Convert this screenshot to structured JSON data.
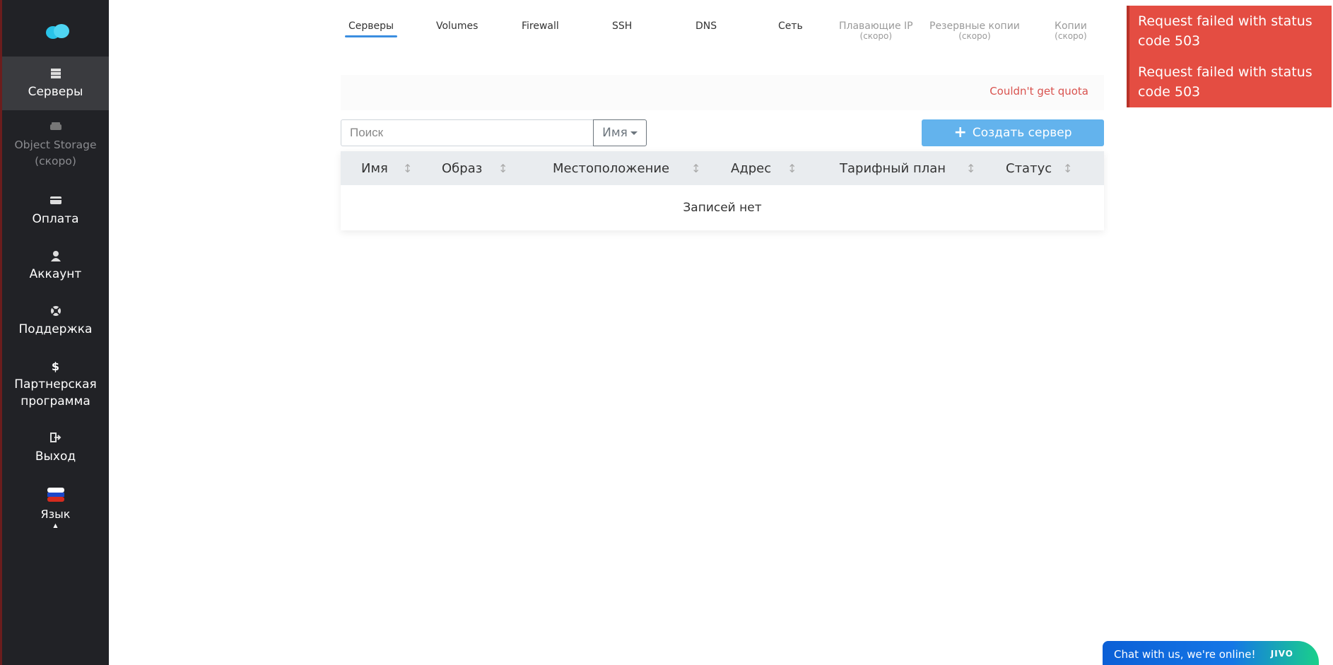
{
  "sidebar": {
    "items": [
      {
        "label": "Серверы",
        "icon": "server-icon"
      },
      {
        "label": "Object Storage (скоро)",
        "icon": "storage-icon"
      },
      {
        "label": "Оплата",
        "icon": "credit-card-icon"
      },
      {
        "label": "Аккаунт",
        "icon": "user-icon"
      },
      {
        "label": "Поддержка",
        "icon": "support-icon"
      },
      {
        "label": "Партнерская программа",
        "icon": "dollar-icon"
      },
      {
        "label": "Выход",
        "icon": "logout-icon"
      },
      {
        "label": "Язык",
        "icon": "flag-ru-icon"
      }
    ]
  },
  "tabs": [
    {
      "label": "Серверы"
    },
    {
      "label": "Volumes"
    },
    {
      "label": "Firewall"
    },
    {
      "label": "SSH"
    },
    {
      "label": "DNS"
    },
    {
      "label": "Сеть"
    },
    {
      "label": "Плавающие IP",
      "sub": "(скоро)"
    },
    {
      "label": "Резервные копии",
      "sub": "(скоро)"
    },
    {
      "label": "Копии",
      "sub": "(скоро)"
    }
  ],
  "quota": {
    "message": "Couldn't get quota"
  },
  "search": {
    "placeholder": "Поиск",
    "filter_label": "Имя"
  },
  "create_button": {
    "label": "Создать сервер"
  },
  "table": {
    "columns": [
      "Имя",
      "Образ",
      "Местоположение",
      "Адрес",
      "Тарифный план",
      "Статус"
    ],
    "empty_text": "Записей нет"
  },
  "toasts": [
    {
      "message": "Request failed with status code 503"
    },
    {
      "message": "Request failed with status code 503"
    }
  ],
  "chat": {
    "text": "Chat with us, we're online!",
    "brand": "JIVO"
  },
  "colors": {
    "sidebar_bg": "#212226",
    "accent": "#3b8ee0",
    "create_button": "#63b3ed",
    "toast_bg": "#e44d42",
    "error_text": "#d9534f"
  }
}
